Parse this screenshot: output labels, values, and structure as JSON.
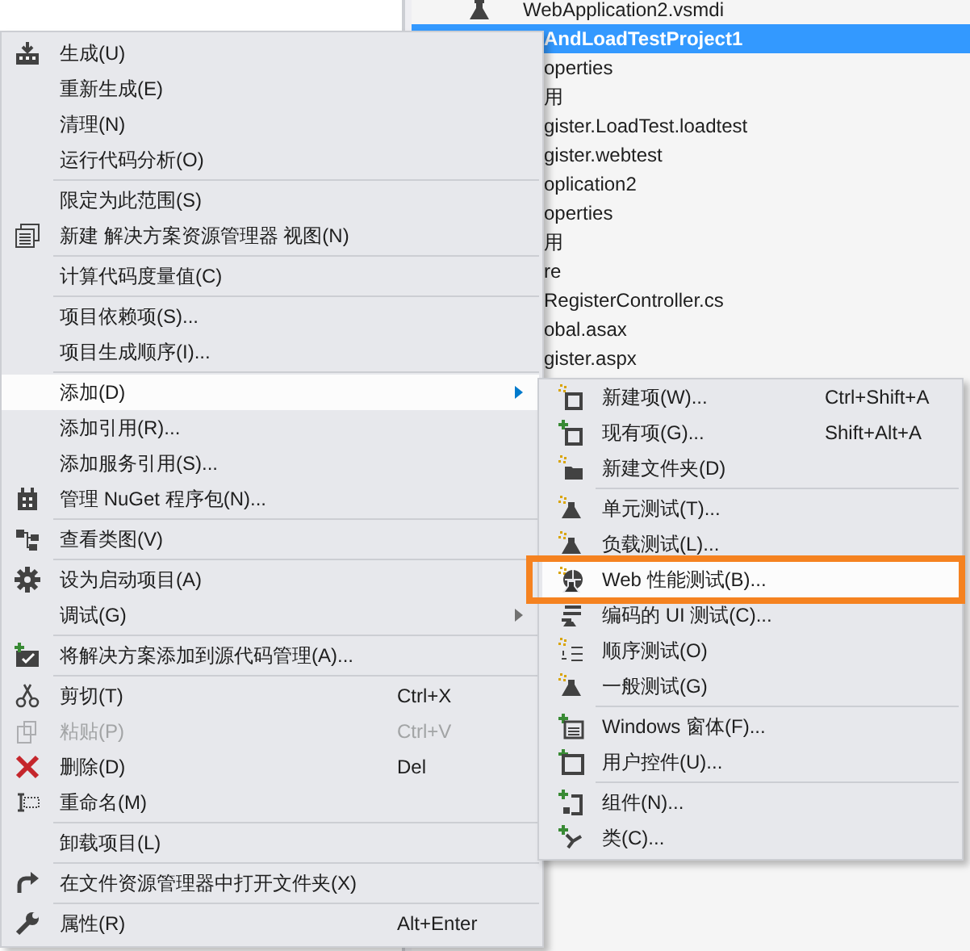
{
  "solution_explorer": {
    "items": [
      {
        "label": "WebApplication2.vsmdi",
        "selected": false
      },
      {
        "label": "AndLoadTestProject1",
        "selected": true
      },
      {
        "label": "operties",
        "selected": false
      },
      {
        "label": "用",
        "selected": false
      },
      {
        "label": "gister.LoadTest.loadtest",
        "selected": false
      },
      {
        "label": "gister.webtest",
        "selected": false
      },
      {
        "label": "oplication2",
        "selected": false
      },
      {
        "label": "operties",
        "selected": false
      },
      {
        "label": "用",
        "selected": false
      },
      {
        "label": "re",
        "selected": false
      },
      {
        "label": "RegisterController.cs",
        "selected": false
      },
      {
        "label": "obal.asax",
        "selected": false
      },
      {
        "label": "gister.aspx",
        "selected": false
      }
    ]
  },
  "context_menu": {
    "items": [
      {
        "kind": "item",
        "label": "生成(U)",
        "selected": false,
        "disabled": false,
        "submenu": false
      },
      {
        "kind": "item",
        "label": "重新生成(E)",
        "selected": false,
        "disabled": false,
        "submenu": false
      },
      {
        "kind": "item",
        "label": "清理(N)",
        "selected": false,
        "disabled": false,
        "submenu": false
      },
      {
        "kind": "item",
        "label": "运行代码分析(O)",
        "selected": false,
        "disabled": false,
        "submenu": false
      },
      {
        "kind": "separator"
      },
      {
        "kind": "item",
        "label": "限定为此范围(S)",
        "selected": false,
        "disabled": false,
        "submenu": false
      },
      {
        "kind": "item",
        "label": "新建 解决方案资源管理器 视图(N)",
        "selected": false,
        "disabled": false,
        "submenu": false
      },
      {
        "kind": "separator"
      },
      {
        "kind": "item",
        "label": "计算代码度量值(C)",
        "selected": false,
        "disabled": false,
        "submenu": false
      },
      {
        "kind": "separator"
      },
      {
        "kind": "item",
        "label": "项目依赖项(S)...",
        "selected": false,
        "disabled": false,
        "submenu": false
      },
      {
        "kind": "item",
        "label": "项目生成顺序(I)...",
        "selected": false,
        "disabled": false,
        "submenu": false
      },
      {
        "kind": "separator"
      },
      {
        "kind": "item",
        "label": "添加(D)",
        "selected": true,
        "disabled": false,
        "submenu": true
      },
      {
        "kind": "item",
        "label": "添加引用(R)...",
        "selected": false,
        "disabled": false,
        "submenu": false
      },
      {
        "kind": "item",
        "label": "添加服务引用(S)...",
        "selected": false,
        "disabled": false,
        "submenu": false
      },
      {
        "kind": "item",
        "label": "管理 NuGet 程序包(N)...",
        "selected": false,
        "disabled": false,
        "submenu": false
      },
      {
        "kind": "separator"
      },
      {
        "kind": "item",
        "label": "查看类图(V)",
        "selected": false,
        "disabled": false,
        "submenu": false
      },
      {
        "kind": "separator"
      },
      {
        "kind": "item",
        "label": "设为启动项目(A)",
        "selected": false,
        "disabled": false,
        "submenu": false
      },
      {
        "kind": "item",
        "label": "调试(G)",
        "selected": false,
        "disabled": false,
        "submenu": true
      },
      {
        "kind": "separator"
      },
      {
        "kind": "item",
        "label": "将解决方案添加到源代码管理(A)...",
        "selected": false,
        "disabled": false,
        "submenu": false
      },
      {
        "kind": "separator"
      },
      {
        "kind": "item",
        "label": "剪切(T)",
        "shortcut": "Ctrl+X",
        "selected": false,
        "disabled": false,
        "submenu": false
      },
      {
        "kind": "item",
        "label": "粘贴(P)",
        "shortcut": "Ctrl+V",
        "selected": false,
        "disabled": true,
        "submenu": false
      },
      {
        "kind": "item",
        "label": "删除(D)",
        "shortcut": "Del",
        "selected": false,
        "disabled": false,
        "submenu": false
      },
      {
        "kind": "item",
        "label": "重命名(M)",
        "selected": false,
        "disabled": false,
        "submenu": false
      },
      {
        "kind": "separator"
      },
      {
        "kind": "item",
        "label": "卸载项目(L)",
        "selected": false,
        "disabled": false,
        "submenu": false
      },
      {
        "kind": "separator"
      },
      {
        "kind": "item",
        "label": "在文件资源管理器中打开文件夹(X)",
        "selected": false,
        "disabled": false,
        "submenu": false
      },
      {
        "kind": "separator"
      },
      {
        "kind": "item",
        "label": "属性(R)",
        "shortcut": "Alt+Enter",
        "selected": false,
        "disabled": false,
        "submenu": false
      }
    ]
  },
  "add_submenu": {
    "items": [
      {
        "kind": "item",
        "label": "新建项(W)...",
        "shortcut": "Ctrl+Shift+A",
        "selected": false,
        "outlined": false
      },
      {
        "kind": "item",
        "label": "现有项(G)...",
        "shortcut": "Shift+Alt+A",
        "selected": false,
        "outlined": false
      },
      {
        "kind": "item",
        "label": "新建文件夹(D)",
        "selected": false,
        "outlined": false
      },
      {
        "kind": "separator"
      },
      {
        "kind": "item",
        "label": "单元测试(T)...",
        "selected": false,
        "outlined": false
      },
      {
        "kind": "item",
        "label": "负载测试(L)...",
        "selected": false,
        "outlined": false
      },
      {
        "kind": "item",
        "label": "Web 性能测试(B)...",
        "selected": true,
        "outlined": true
      },
      {
        "kind": "item",
        "label": "编码的 UI 测试(C)...",
        "selected": false,
        "outlined": false
      },
      {
        "kind": "item",
        "label": "顺序测试(O)",
        "selected": false,
        "outlined": false
      },
      {
        "kind": "item",
        "label": "一般测试(G)",
        "selected": false,
        "outlined": false
      },
      {
        "kind": "separator"
      },
      {
        "kind": "item",
        "label": "Windows 窗体(F)...",
        "selected": false,
        "outlined": false
      },
      {
        "kind": "item",
        "label": "用户控件(U)...",
        "selected": false,
        "outlined": false
      },
      {
        "kind": "separator"
      },
      {
        "kind": "item",
        "label": "组件(N)...",
        "selected": false,
        "outlined": false
      },
      {
        "kind": "item",
        "label": "类(C)...",
        "selected": false,
        "outlined": false
      }
    ]
  }
}
